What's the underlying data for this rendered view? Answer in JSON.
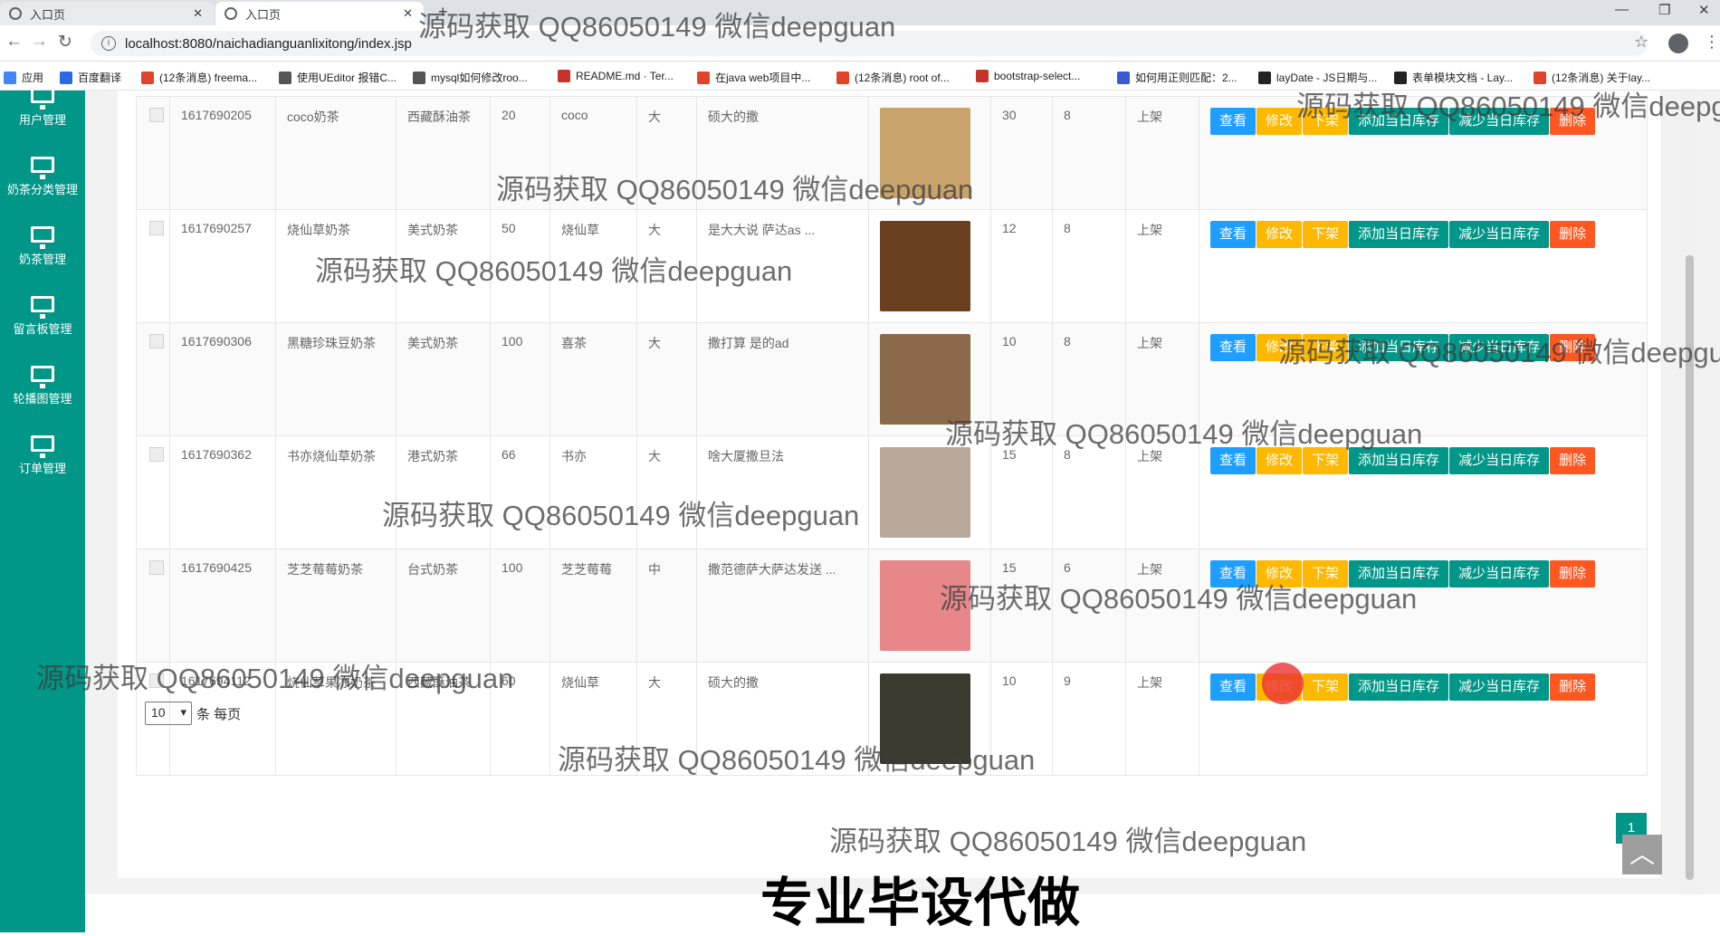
{
  "browser": {
    "tabs": [
      {
        "title": "入口页",
        "close": "✕"
      },
      {
        "title": "入口页",
        "close": "✕"
      }
    ],
    "new_tab": "+",
    "window_controls": [
      "—",
      "❐",
      "✕"
    ],
    "url": "localhost:8080/naichadianguanlixitong/index.jsp",
    "bookmarks": [
      {
        "label": "应用",
        "color": "#4285f4"
      },
      {
        "label": "百度翻译",
        "color": "#2b6ae0"
      },
      {
        "label": "(12条消息) freema...",
        "color": "#e0442a"
      },
      {
        "label": "使用UEditor 报错C...",
        "color": "#555555"
      },
      {
        "label": "mysql如何修改roo...",
        "color": "#555555"
      },
      {
        "label": "README.md · Ter...",
        "color": "#c7322b"
      },
      {
        "label": "在java web项目中...",
        "color": "#e0442a"
      },
      {
        "label": "(12条消息) root of...",
        "color": "#e0442a"
      },
      {
        "label": "bootstrap-select...",
        "color": "#c7322b"
      },
      {
        "label": "如何用正则匹配：2...",
        "color": "#3a5bcc"
      },
      {
        "label": "layDate - JS日期与...",
        "color": "#222222"
      },
      {
        "label": "表单模块文档 - Lay...",
        "color": "#222222"
      },
      {
        "label": "(12条消息) 关于lay...",
        "color": "#e0442a"
      }
    ]
  },
  "sidebar": {
    "items": [
      {
        "label": "用户管理"
      },
      {
        "label": "奶茶分类管理"
      },
      {
        "label": "奶茶管理"
      },
      {
        "label": "留言板管理"
      },
      {
        "label": "轮播图管理"
      },
      {
        "label": "订单管理"
      }
    ]
  },
  "table": {
    "rows": [
      {
        "id": "1617690205",
        "name": "coco奶茶",
        "category": "西藏酥油茶",
        "price": "20",
        "brand": "coco",
        "size": "大",
        "desc": "硕大的撒",
        "c1": "30",
        "c2": "8",
        "status": "上架",
        "img_color": "#c9a36c"
      },
      {
        "id": "1617690257",
        "name": "烧仙草奶茶",
        "category": "美式奶茶",
        "price": "50",
        "brand": "烧仙草",
        "size": "大",
        "desc": "是大大说 萨达as ...",
        "c1": "12",
        "c2": "8",
        "status": "上架",
        "img_color": "#6b3e1f"
      },
      {
        "id": "1617690306",
        "name": "黑糖珍珠豆奶茶",
        "category": "美式奶茶",
        "price": "100",
        "brand": "喜茶",
        "size": "大",
        "desc": "撒打算 是的ad",
        "c1": "10",
        "c2": "8",
        "status": "上架",
        "img_color": "#8a6a4a"
      },
      {
        "id": "1617690362",
        "name": "书亦烧仙草奶茶",
        "category": "港式奶茶",
        "price": "66",
        "brand": "书亦",
        "size": "大",
        "desc": "啥大厦撒旦法",
        "c1": "15",
        "c2": "8",
        "status": "上架",
        "img_color": "#b9a89a"
      },
      {
        "id": "1617690425",
        "name": "芝芝莓莓奶茶",
        "category": "台式奶茶",
        "price": "100",
        "brand": "芝芝莓莓",
        "size": "中",
        "desc": "撒范德萨大萨达发送 ...",
        "c1": "15",
        "c2": "6",
        "status": "上架",
        "img_color": "#e8878a"
      },
      {
        "id": "1617694112",
        "name": "烧仙草果冻奶茶",
        "category": "西藏酥油茶",
        "price": "60",
        "brand": "烧仙草",
        "size": "大",
        "desc": "硕大的撒",
        "c1": "10",
        "c2": "9",
        "status": "上架",
        "img_color": "#3a3a2e"
      }
    ],
    "actions": [
      "查看",
      "修改",
      "下架",
      "添加当日库存",
      "减少当日库存",
      "删除"
    ]
  },
  "pager": {
    "per_page": "10",
    "suffix": "条 每页",
    "page": "1",
    "to_top": "︿"
  },
  "overlay": {
    "watermark": "源码获取 QQ86050149 微信deepguan",
    "banner": "专业毕设代做"
  }
}
